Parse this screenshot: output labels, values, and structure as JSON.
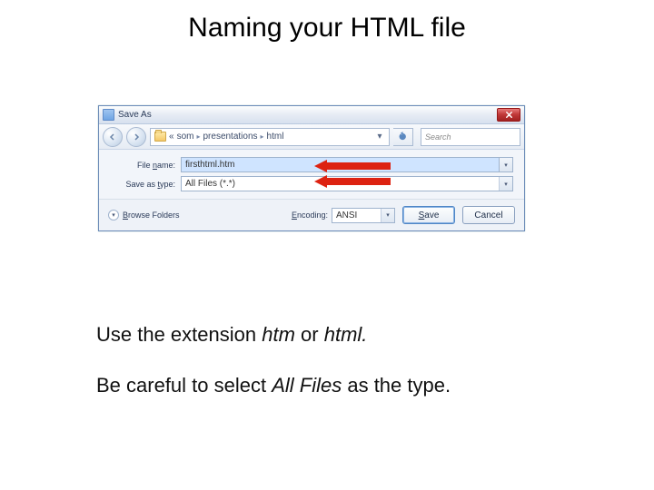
{
  "slide": {
    "title": "Naming your HTML file",
    "captions": {
      "line1_prefix": "Use the extension ",
      "line1_em1": "htm",
      "line1_mid": " or ",
      "line1_em2": "html.",
      "line2_prefix": "Be careful to select ",
      "line2_em": "All Files",
      "line2_suffix": " as the type."
    }
  },
  "dialog": {
    "title": "Save As",
    "breadcrumb": {
      "seg1": "som",
      "seg2": "presentations",
      "seg3": "html",
      "prefix": "«"
    },
    "search_placeholder": "Search",
    "filename_label": "File name:",
    "filename_value": "firsthtml.htm",
    "filetype_label": "Save as type:",
    "filetype_value": "All Files (*.*)",
    "browse_label": "Browse Folders",
    "encoding_label": "Encoding:",
    "encoding_value": "ANSI",
    "save_label": "Save",
    "cancel_label": "Cancel"
  }
}
